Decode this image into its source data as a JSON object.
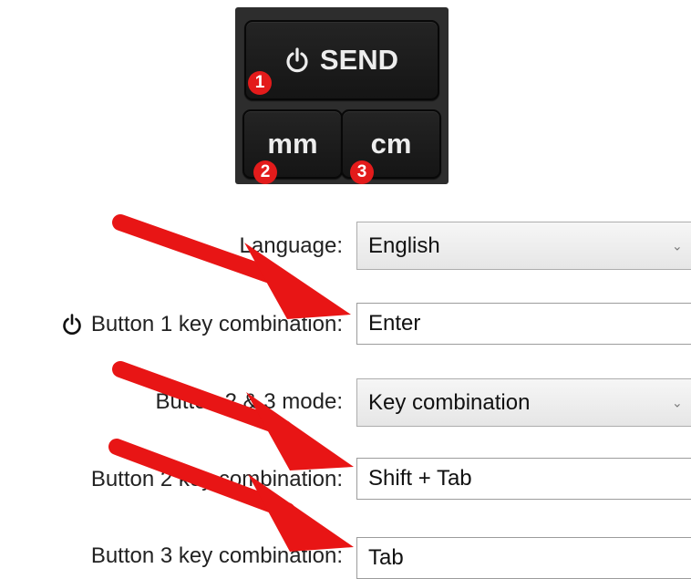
{
  "device": {
    "send_label": "SEND",
    "mm_label": "mm",
    "cm_label": "cm",
    "badges": [
      "1",
      "2",
      "3"
    ],
    "power_icon": "power-icon"
  },
  "form": {
    "language": {
      "label": "Language:",
      "value": "English"
    },
    "button1": {
      "label": "Button 1 key combination:",
      "value": "Enter"
    },
    "mode": {
      "label": "Button 2 & 3 mode:",
      "value": "Key combination"
    },
    "button2": {
      "label": "Button 2 key combination:",
      "value": "Shift + Tab"
    },
    "button3": {
      "label": "Button 3 key combination:",
      "value": "Tab"
    },
    "chevron_glyph": "⌄"
  },
  "colors": {
    "arrow": "#e81515",
    "badge": "#e31b1b",
    "device_bg": "#2d2d2d"
  }
}
